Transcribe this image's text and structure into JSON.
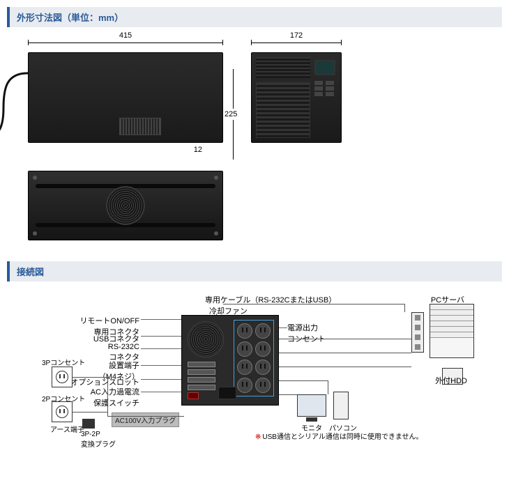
{
  "sections": {
    "outline_title": "外形寸法図（単位：mm）",
    "connection_title": "接続図"
  },
  "dimensions": {
    "width": "415",
    "depth": "172",
    "height": "225",
    "foot": "12"
  },
  "connection": {
    "cable_label": "専用ケーブル（RS-232CまたはUSB）",
    "labels": {
      "remote_onoff": "リモートON/OFF\n専用コネクタ",
      "usb": "USBコネクタ",
      "rs232c": "RS-232C\nコネクタ",
      "ground": "設置端子\n（M4ネジ）",
      "option_slot": "オプションスロット",
      "ac_overcurrent": "AC入力過電流\n保護スイッチ",
      "cooling_fan": "冷却ファン",
      "power_outlet": "電源出力\nコンセント",
      "pc_server": "PCサーバ",
      "ext_hdd": "外付HDD",
      "monitor": "モニタ",
      "pc": "パソコン",
      "outlet_3p": "3Pコンセント",
      "outlet_2p": "2Pコンセント",
      "earth": "アース端子",
      "adapter": "3P-2P\n変換プラグ",
      "ac_plug": "AC100V入力プラグ"
    },
    "note_star": "※",
    "note_text": "USB通信とシリアル通信は同時に使用できません。"
  }
}
